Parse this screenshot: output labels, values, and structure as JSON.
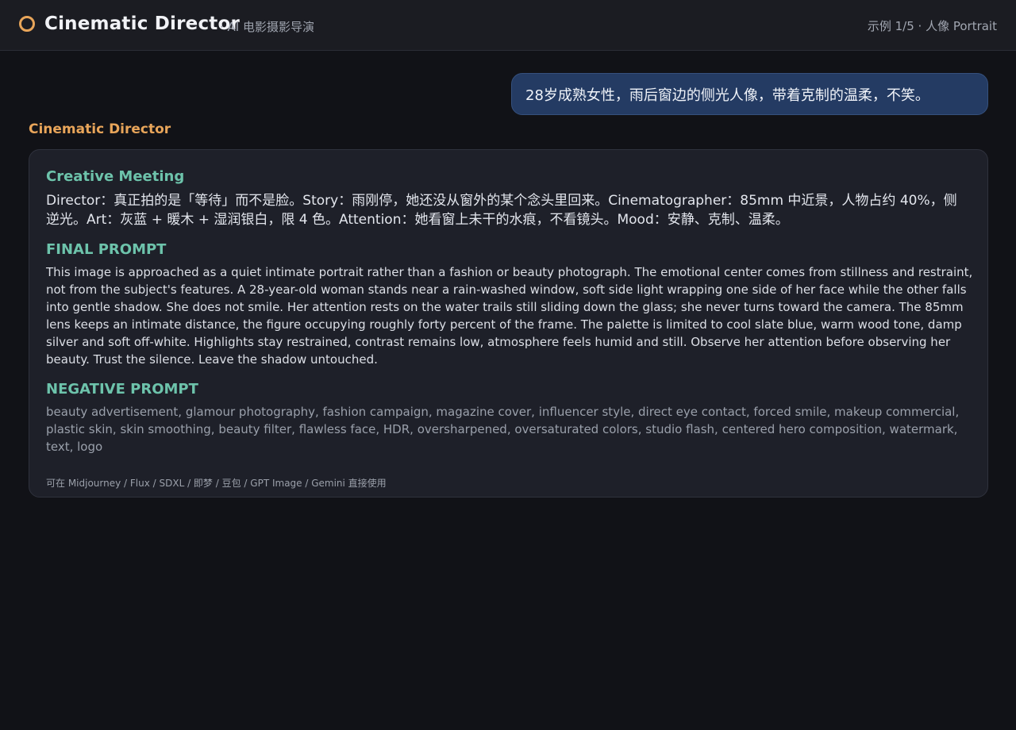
{
  "header": {
    "logo_icon": "ring-icon",
    "accent_color": "#e8a55a",
    "title": "Cinematic Director",
    "subtitle": "· AI 电影摄影导演",
    "example_indicator": "示例 1/5 · 人像 Portrait"
  },
  "chat": {
    "user_message": "28岁成熟女性，雨后窗边的侧光人像，带着克制的温柔，不笑。",
    "assistant_name": "Cinematic Director",
    "response": {
      "meeting_title": "Creative Meeting",
      "meeting_text": "Director：真正拍的是「等待」而不是脸。Story：雨刚停，她还没从窗外的某个念头里回来。Cinematographer：85mm 中近景，人物占约 40%，侧逆光。Art：灰蓝 + 暖木 + 湿润银白，限 4 色。Attention：她看窗上未干的水痕，不看镜头。Mood：安静、克制、温柔。",
      "final_title": "FINAL PROMPT",
      "final_text": "This image is approached as a quiet intimate portrait rather than a fashion or beauty photograph. The emotional center comes from stillness and restraint, not from the subject's features. A 28-year-old woman stands near a rain-washed window, soft side light wrapping one side of her face while the other falls into gentle shadow. She does not smile. Her attention rests on the water trails still sliding down the glass; she never turns toward the camera. The 85mm lens keeps an intimate distance, the figure occupying roughly forty percent of the frame. The palette is limited to cool slate blue, warm wood tone, damp silver and soft off-white. Highlights stay restrained, contrast remains low, atmosphere feels humid and still. Observe her attention before observing her beauty. Trust the silence. Leave the shadow untouched.",
      "negative_title": "NEGATIVE PROMPT",
      "negative_text": "beauty advertisement, glamour photography, fashion campaign, magazine cover, influencer style, direct eye contact, forced smile, makeup commercial, plastic skin, skin smoothing, beauty filter, flawless face, HDR, oversharpened, oversaturated colors, studio flash, centered hero composition, watermark, text, logo",
      "usage_note": "可在 Midjourney / Flux / SDXL / 即梦 / 豆包 / GPT Image / Gemini 直接使用"
    }
  }
}
